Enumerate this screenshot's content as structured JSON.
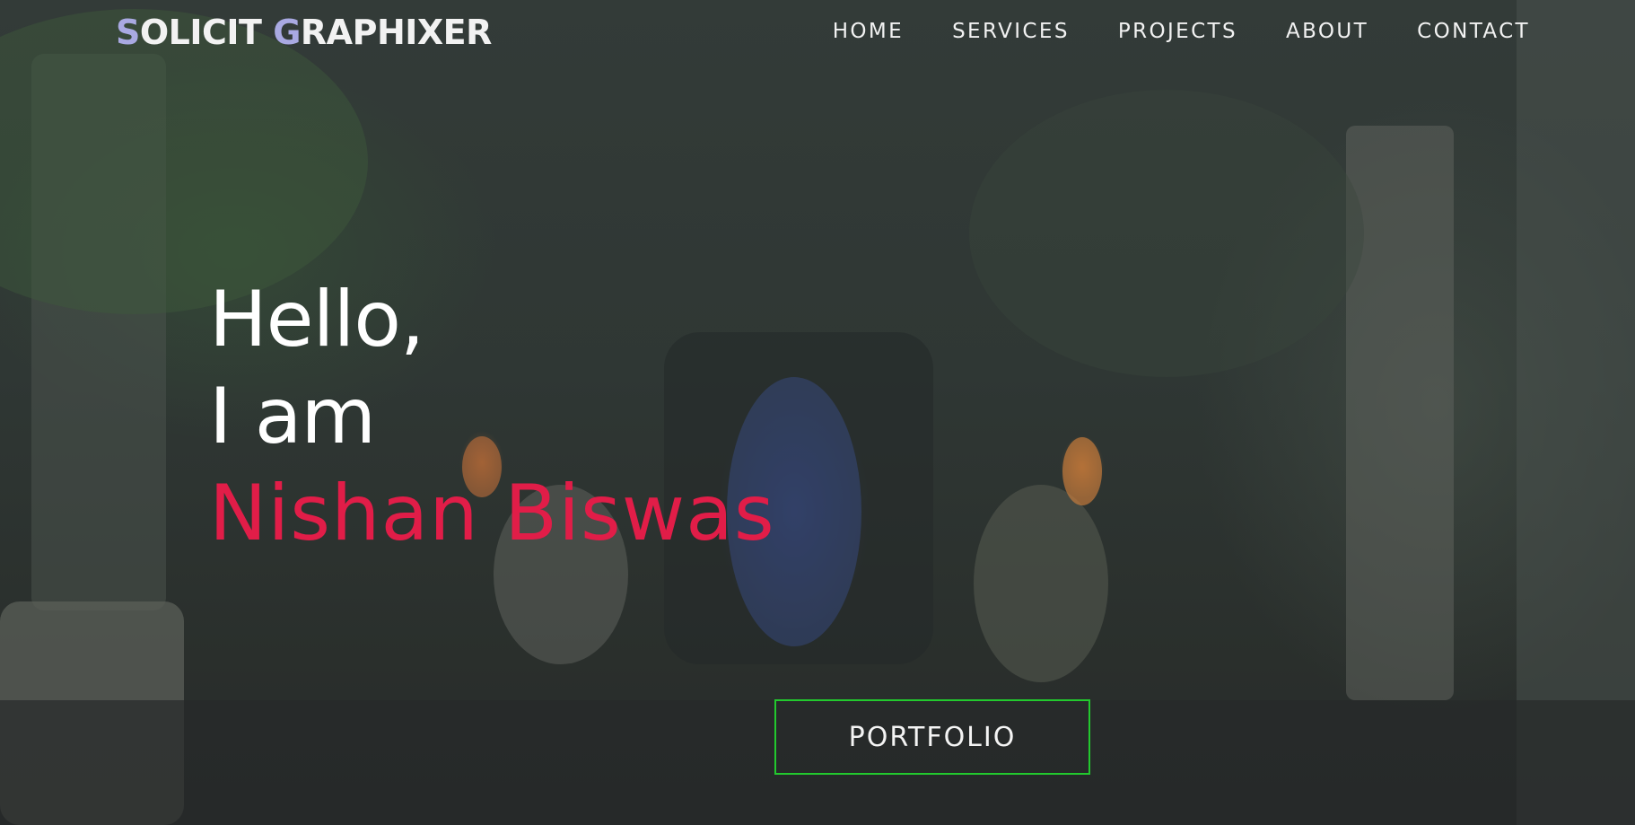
{
  "brand": {
    "first_initial": "S",
    "first_rest": "OLICIT ",
    "second_initial": "G",
    "second_rest": "RAPHIXER"
  },
  "nav": {
    "items": [
      {
        "label": "HOME"
      },
      {
        "label": "SERVICES"
      },
      {
        "label": "PROJECTS"
      },
      {
        "label": "ABOUT"
      },
      {
        "label": "CONTACT"
      }
    ]
  },
  "hero": {
    "greeting": "Hello,",
    "intro": "I am",
    "name": "Nishan Biswas",
    "cta_label": "PORTFOLIO"
  },
  "colors": {
    "logo_accent": "#a9a9e2",
    "name_accent": "#e11d48",
    "button_border": "#22c92e"
  }
}
